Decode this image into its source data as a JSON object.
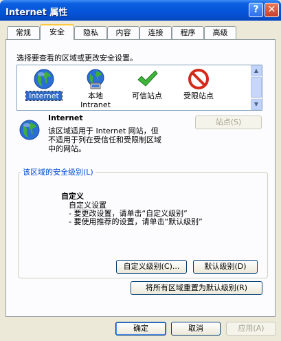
{
  "window": {
    "title": "Internet 属性",
    "help_btn": "?",
    "close_btn": "✕"
  },
  "tabs": [
    "常规",
    "安全",
    "隐私",
    "内容",
    "连接",
    "程序",
    "高级"
  ],
  "active_tab": "安全",
  "security": {
    "instruction": "选择要查看的区域或更改安全设置。",
    "zones": [
      {
        "label": "Internet",
        "icon": "globe-icon",
        "selected": true
      },
      {
        "label": "本地\nIntranet",
        "icon": "intranet-icon",
        "selected": false
      },
      {
        "label": "可信站点",
        "icon": "checkmark-icon",
        "selected": false
      },
      {
        "label": "受限站点",
        "icon": "prohibited-icon",
        "selected": false
      }
    ],
    "zone_name": "Internet",
    "zone_desc": "该区域适用于 Internet 网站，但\n不适用于列在受信任和受限制区域\n中的网站。",
    "sites_button": "站点(S)"
  },
  "level_group": {
    "legend": "该区域的安全级别(L)",
    "level_title": "自定义",
    "level_desc": "自定义设置\n- 要更改设置，请单击“自定义级别”\n- 要使用推荐的设置，请单击“默认级别”",
    "custom_button": "自定义级别(C)...",
    "default_button": "默认级别(D)"
  },
  "reset_all_button": "将所有区域重置为默认级别(R)",
  "footer": {
    "ok": "确定",
    "cancel": "取消",
    "apply": "应用(A)"
  }
}
